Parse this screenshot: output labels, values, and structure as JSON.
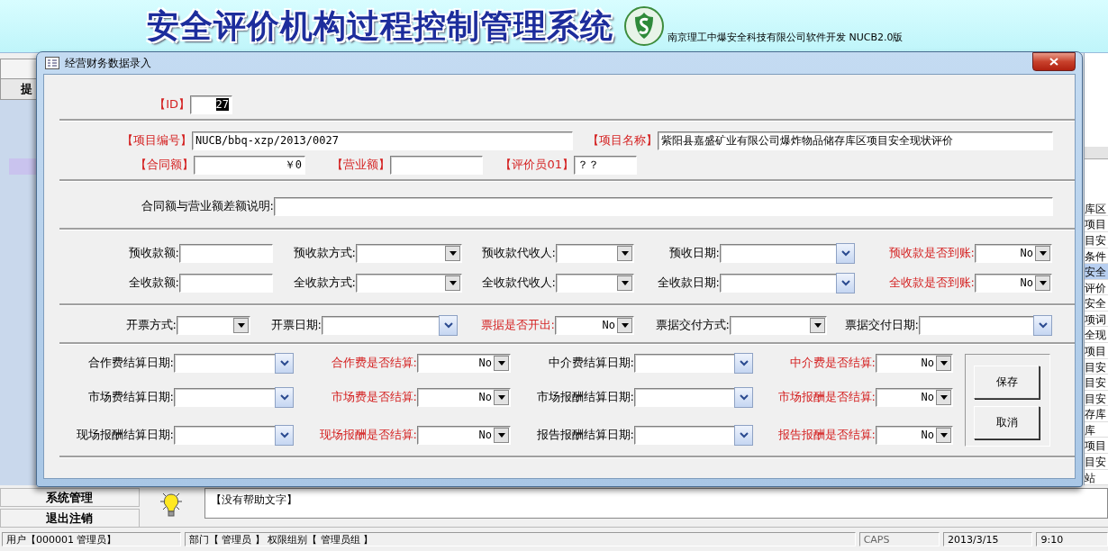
{
  "app": {
    "title": "安全评价机构过程控制管理系统",
    "vendor": "南京理工中爆安全科技有限公司软件开发 NUCB2.0版",
    "nav_header": "提",
    "list_items": [
      {
        "text": "库区",
        "selected": false
      },
      {
        "text": "项目",
        "selected": false
      },
      {
        "text": "目安",
        "selected": false
      },
      {
        "text": "条件",
        "selected": false
      },
      {
        "text": "安全",
        "selected": true
      },
      {
        "text": "评价",
        "selected": false
      },
      {
        "text": "安全",
        "selected": false
      },
      {
        "text": "项词",
        "selected": false
      },
      {
        "text": "全现",
        "selected": false
      },
      {
        "text": "项目",
        "selected": false
      },
      {
        "text": "目安",
        "selected": false
      },
      {
        "text": "目安",
        "selected": false
      },
      {
        "text": "目安",
        "selected": false
      },
      {
        "text": "存库",
        "selected": false
      },
      {
        "text": "库",
        "selected": false
      },
      {
        "text": "项目",
        "selected": false
      },
      {
        "text": "目安",
        "selected": false
      },
      {
        "text": "站",
        "selected": false
      }
    ],
    "menu": [
      {
        "label": "系统管理"
      },
      {
        "label": "退出注销"
      }
    ],
    "help_text": "【没有帮助文字】",
    "status": [
      "用户【000001 管理员】",
      "部门【 管理员 】 权限组别【 管理员组 】",
      "CAPS",
      "2013/3/15",
      "9:10"
    ]
  },
  "dialog": {
    "title": "经营财务数据录入",
    "sections": [
      {
        "rows": [
          {
            "fields": [
              {
                "label": "【ID】",
                "emphasis": true,
                "kind": "text",
                "value": "27",
                "numeric": true,
                "value_selected": true
              }
            ]
          }
        ]
      },
      {
        "rows": [
          {
            "fields": [
              {
                "label": "【项目编号】",
                "emphasis": true,
                "kind": "text",
                "value": "NUCB/bbq-xzp/2013/0027",
                "numeric": false
              },
              {
                "label": "【项目名称】",
                "emphasis": true,
                "kind": "text",
                "value": "紫阳县嘉盛矿业有限公司爆炸物品储存库区项目安全现状评价",
                "numeric": false
              }
            ]
          },
          {
            "fields": [
              {
                "label": "【合同额】",
                "emphasis": true,
                "kind": "text",
                "value": "￥0",
                "numeric": true
              },
              {
                "label": "【营业额】",
                "emphasis": true,
                "kind": "text"
              },
              {
                "label": "【评价员01】",
                "emphasis": true,
                "kind": "text",
                "value": "？？",
                "numeric": false
              }
            ]
          }
        ]
      },
      {
        "rows": [
          {
            "fields": [
              {
                "label": "合同额与营业额差额说明:",
                "emphasis": false,
                "kind": "text"
              }
            ]
          }
        ]
      },
      {
        "rows": [
          {
            "fields": [
              {
                "label": "预收款额:",
                "emphasis": false,
                "kind": "text"
              },
              {
                "label": "预收款方式:",
                "emphasis": false,
                "kind": "combo"
              },
              {
                "label": "预收款代收人:",
                "emphasis": false,
                "kind": "combo"
              },
              {
                "label": "预收日期:",
                "emphasis": false,
                "kind": "date"
              },
              {
                "label": "预收款是否到账:",
                "emphasis": true,
                "kind": "combo",
                "value": "No"
              }
            ]
          },
          {
            "fields": [
              {
                "label": "全收款额:",
                "emphasis": false,
                "kind": "text"
              },
              {
                "label": "全收款方式:",
                "emphasis": false,
                "kind": "combo"
              },
              {
                "label": "全收款代收人:",
                "emphasis": false,
                "kind": "combo"
              },
              {
                "label": "全收款日期:",
                "emphasis": false,
                "kind": "date"
              },
              {
                "label": "全收款是否到账:",
                "emphasis": true,
                "kind": "combo",
                "value": "No"
              }
            ]
          }
        ]
      },
      {
        "rows": [
          {
            "fields": [
              {
                "label": "开票方式:",
                "emphasis": false,
                "kind": "combo"
              },
              {
                "label": "开票日期:",
                "emphasis": false,
                "kind": "date"
              },
              {
                "label": "票据是否开出:",
                "emphasis": true,
                "kind": "combo",
                "value": "No"
              },
              {
                "label": "票据交付方式:",
                "emphasis": false,
                "kind": "combo"
              },
              {
                "label": "票据交付日期:",
                "emphasis": false,
                "kind": "date"
              }
            ]
          }
        ]
      },
      {
        "rows": [
          {
            "fields": [
              {
                "label": "合作费结算日期:",
                "emphasis": false,
                "kind": "date"
              },
              {
                "label": "合作费是否结算:",
                "emphasis": true,
                "kind": "combo",
                "value": "No"
              },
              {
                "label": "中介费结算日期:",
                "emphasis": false,
                "kind": "date"
              },
              {
                "label": "中介费是否结算:",
                "emphasis": true,
                "kind": "combo",
                "value": "No"
              }
            ]
          },
          {
            "fields": [
              {
                "label": "市场费结算日期:",
                "emphasis": false,
                "kind": "date"
              },
              {
                "label": "市场费是否结算:",
                "emphasis": true,
                "kind": "combo",
                "value": "No"
              },
              {
                "label": "市场报酬结算日期:",
                "emphasis": false,
                "kind": "date"
              },
              {
                "label": "市场报酬是否结算:",
                "emphasis": true,
                "kind": "combo",
                "value": "No"
              }
            ]
          },
          {
            "fields": [
              {
                "label": "现场报酬结算日期:",
                "emphasis": false,
                "kind": "date"
              },
              {
                "label": "现场报酬是否结算:",
                "emphasis": true,
                "kind": "combo",
                "value": "No"
              },
              {
                "label": "报告报酬结算日期:",
                "emphasis": false,
                "kind": "date"
              },
              {
                "label": "报告报酬是否结算:",
                "emphasis": true,
                "kind": "combo",
                "value": "No"
              }
            ]
          }
        ]
      }
    ],
    "buttons": [
      "保存",
      "取消"
    ]
  }
}
